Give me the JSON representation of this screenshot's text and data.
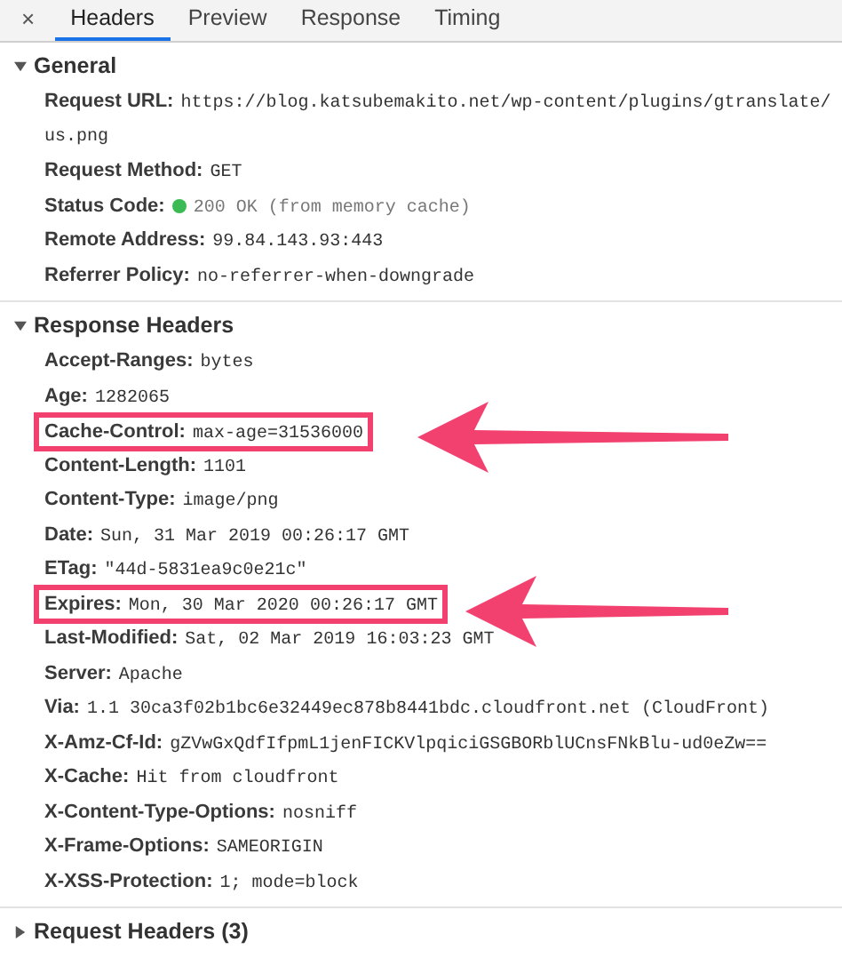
{
  "close_button": "×",
  "tabs": [
    {
      "label": "Headers",
      "selected": true
    },
    {
      "label": "Preview",
      "selected": false
    },
    {
      "label": "Response",
      "selected": false
    },
    {
      "label": "Timing",
      "selected": false
    }
  ],
  "sections": [
    {
      "title": "General",
      "expanded": true,
      "rows": [
        {
          "name": "Request URL:",
          "value_lines": [
            "https://blog.katsubemakito.net/wp-content/plugins/gtranslate/",
            "us.png"
          ],
          "highlighted": false,
          "status_dot": false
        },
        {
          "name": "Request Method:",
          "value_lines": [
            "GET"
          ],
          "highlighted": false,
          "status_dot": false
        },
        {
          "name": "Status Code:",
          "value_lines": [
            "200 OK (from memory cache)"
          ],
          "highlighted": false,
          "status_dot": true
        },
        {
          "name": "Remote Address:",
          "value_lines": [
            "99.84.143.93:443"
          ],
          "highlighted": false,
          "status_dot": false
        },
        {
          "name": "Referrer Policy:",
          "value_lines": [
            "no-referrer-when-downgrade"
          ],
          "highlighted": false,
          "status_dot": false
        }
      ]
    },
    {
      "title": "Response Headers",
      "expanded": true,
      "rows": [
        {
          "name": "Accept-Ranges:",
          "value_lines": [
            "bytes"
          ],
          "highlighted": false,
          "status_dot": false
        },
        {
          "name": "Age:",
          "value_lines": [
            "1282065"
          ],
          "highlighted": false,
          "status_dot": false
        },
        {
          "name": "Cache-Control:",
          "value_lines": [
            "max-age=31536000"
          ],
          "highlighted": true,
          "status_dot": false
        },
        {
          "name": "Content-Length:",
          "value_lines": [
            "1101"
          ],
          "highlighted": false,
          "status_dot": false
        },
        {
          "name": "Content-Type:",
          "value_lines": [
            "image/png"
          ],
          "highlighted": false,
          "status_dot": false
        },
        {
          "name": "Date:",
          "value_lines": [
            "Sun, 31 Mar 2019 00:26:17 GMT"
          ],
          "highlighted": false,
          "status_dot": false
        },
        {
          "name": "ETag:",
          "value_lines": [
            "\"44d-5831ea9c0e21c\""
          ],
          "highlighted": false,
          "status_dot": false
        },
        {
          "name": "Expires:",
          "value_lines": [
            "Mon, 30 Mar 2020 00:26:17 GMT"
          ],
          "highlighted": true,
          "status_dot": false
        },
        {
          "name": "Last-Modified:",
          "value_lines": [
            "Sat, 02 Mar 2019 16:03:23 GMT"
          ],
          "highlighted": false,
          "status_dot": false
        },
        {
          "name": "Server:",
          "value_lines": [
            "Apache"
          ],
          "highlighted": false,
          "status_dot": false
        },
        {
          "name": "Via:",
          "value_lines": [
            "1.1 30ca3f02b1bc6e32449ec878b8441bdc.cloudfront.net (CloudFront)"
          ],
          "highlighted": false,
          "status_dot": false
        },
        {
          "name": "X-Amz-Cf-Id:",
          "value_lines": [
            "gZVwGxQdfIfpmL1jenFICKVlpqiciGSGBORblUCnsFNkBlu-ud0eZw=="
          ],
          "highlighted": false,
          "status_dot": false
        },
        {
          "name": "X-Cache:",
          "value_lines": [
            "Hit from cloudfront"
          ],
          "highlighted": false,
          "status_dot": false
        },
        {
          "name": "X-Content-Type-Options:",
          "value_lines": [
            "nosniff"
          ],
          "highlighted": false,
          "status_dot": false
        },
        {
          "name": "X-Frame-Options:",
          "value_lines": [
            "SAMEORIGIN"
          ],
          "highlighted": false,
          "status_dot": false
        },
        {
          "name": "X-XSS-Protection:",
          "value_lines": [
            "1; mode=block"
          ],
          "highlighted": false,
          "status_dot": false
        }
      ]
    },
    {
      "title": "Request Headers (3)",
      "expanded": false
    }
  ]
}
